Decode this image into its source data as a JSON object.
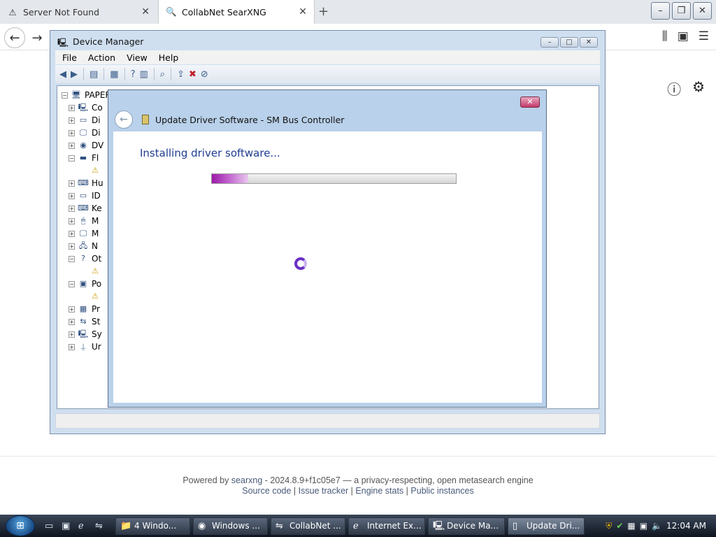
{
  "browser": {
    "tabs": [
      {
        "label": "Server Not Found",
        "icon": "warning-icon"
      },
      {
        "label": "CollabNet SearXNG",
        "icon": "search-icon"
      }
    ]
  },
  "device_manager": {
    "title": "Device Manager",
    "menu": [
      "File",
      "Action",
      "View",
      "Help"
    ],
    "tree": {
      "root_label": "PAPER",
      "items": [
        "Co",
        "Di",
        "Di",
        "DV",
        "Fl",
        "Hu",
        "ID",
        "Ke",
        "M",
        "M",
        "N",
        "Ot",
        "Po",
        "Pr",
        "St",
        "Sy",
        "Ur"
      ]
    }
  },
  "dialog": {
    "title": "Update Driver Software - SM Bus Controller",
    "heading": "Installing driver software...",
    "progress_fraction": 0.15
  },
  "footer": {
    "powered_prefix": "Powered by ",
    "powered_link": "searxng",
    "powered_suffix": " - 2024.8.9+f1c05e7 — a privacy-respecting, open metasearch engine",
    "links": [
      "Source code",
      "Issue tracker",
      "Engine stats",
      "Public instances"
    ]
  },
  "taskbar": {
    "tasks": [
      "4 Windo...",
      "Windows ...",
      "CollabNet ...",
      "Internet Ex...",
      "Device Ma...",
      "Update Dri..."
    ],
    "clock": "12:04 AM"
  }
}
